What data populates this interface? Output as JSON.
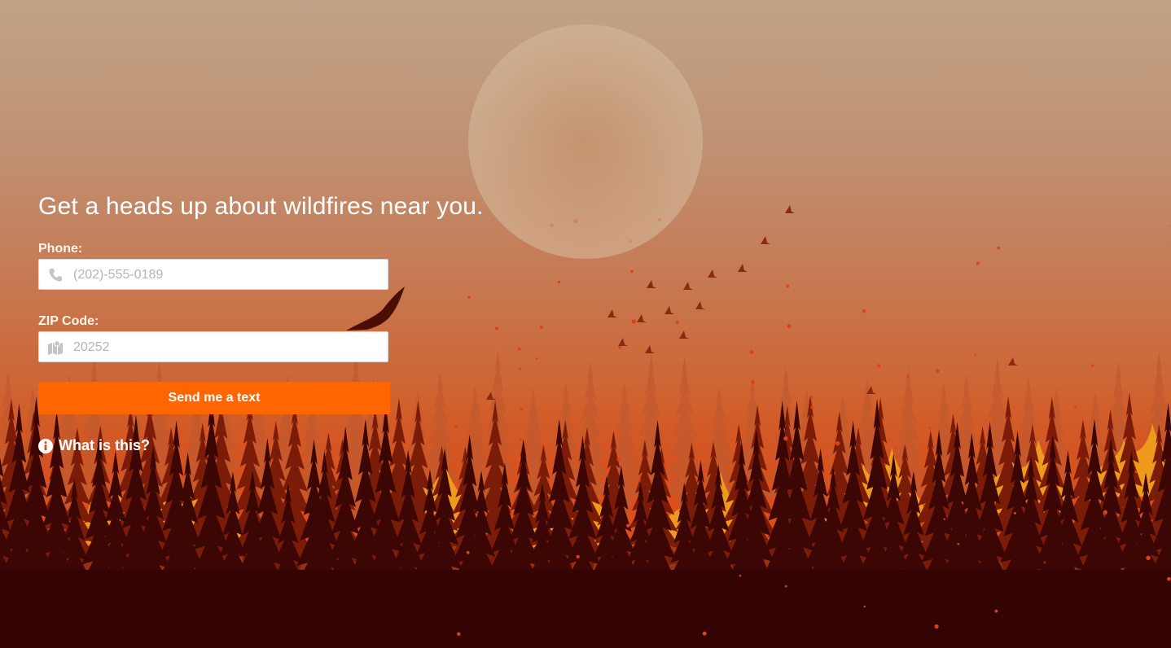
{
  "hero": {
    "headline": "Get a heads up about wildfires near you."
  },
  "form": {
    "phone": {
      "label": "Phone:",
      "placeholder": "(202)-555-0189",
      "value": "",
      "icon": "phone-icon"
    },
    "zip": {
      "label": "ZIP Code:",
      "placeholder": "20252",
      "value": "",
      "icon": "map-icon"
    },
    "submit_label": "Send me a text"
  },
  "info_link": {
    "label": "What is this?",
    "icon": "info-icon"
  },
  "colors": {
    "button": "#ff6602",
    "label": "#fff6e3",
    "headline": "#ffffff",
    "forest_dark": "#3a0503",
    "flame": "#f0a020"
  }
}
